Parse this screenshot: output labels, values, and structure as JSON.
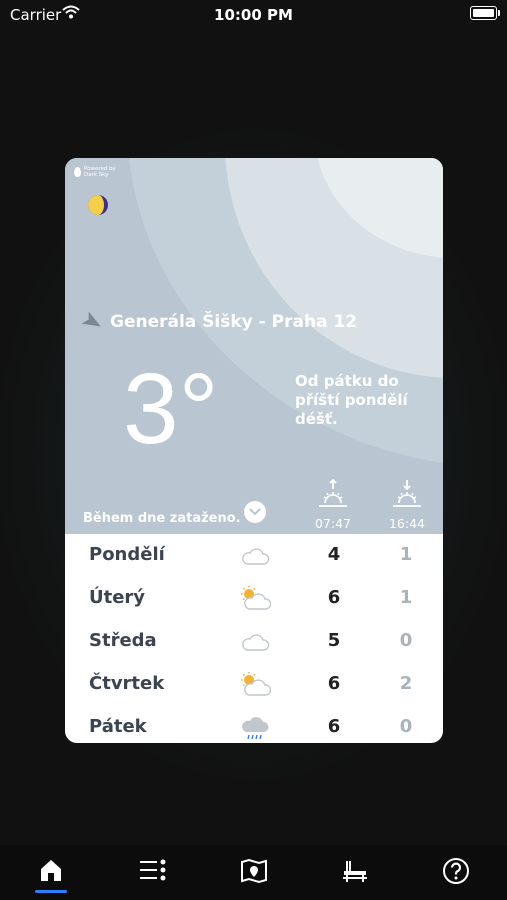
{
  "status_bar": {
    "carrier": "Carrier",
    "time": "10:00 PM"
  },
  "card": {
    "powered_by": [
      "Powered by",
      "Dark Sky"
    ],
    "location": "Generála Šišky - Praha 12",
    "temperature": "3°",
    "forecast_text": "Od pátku do příští pondělí déšť.",
    "summary": "Během dne zataženo.",
    "sunrise": "07:47",
    "sunset": "16:44"
  },
  "days": [
    {
      "day": "Pondělí",
      "icon": "cloud-icon",
      "high": "4",
      "low": "1"
    },
    {
      "day": "Úterý",
      "icon": "partly-sunny-icon",
      "high": "6",
      "low": "1"
    },
    {
      "day": "Středa",
      "icon": "cloud-icon",
      "high": "5",
      "low": "0"
    },
    {
      "day": "Čtvrtek",
      "icon": "partly-sunny-icon",
      "high": "6",
      "low": "2"
    },
    {
      "day": "Pátek",
      "icon": "rain-icon",
      "high": "6",
      "low": "0"
    }
  ],
  "tabs": [
    {
      "name": "home-icon",
      "active": true
    },
    {
      "name": "list-icon",
      "active": false
    },
    {
      "name": "map-icon",
      "active": false
    },
    {
      "name": "bench-icon",
      "active": false
    },
    {
      "name": "help-icon",
      "active": false
    }
  ],
  "colors": {
    "accent": "#2d7dff",
    "card_sky": "#b9c6d1",
    "day_text": "#3b4450",
    "low_text": "#aab2ba"
  }
}
